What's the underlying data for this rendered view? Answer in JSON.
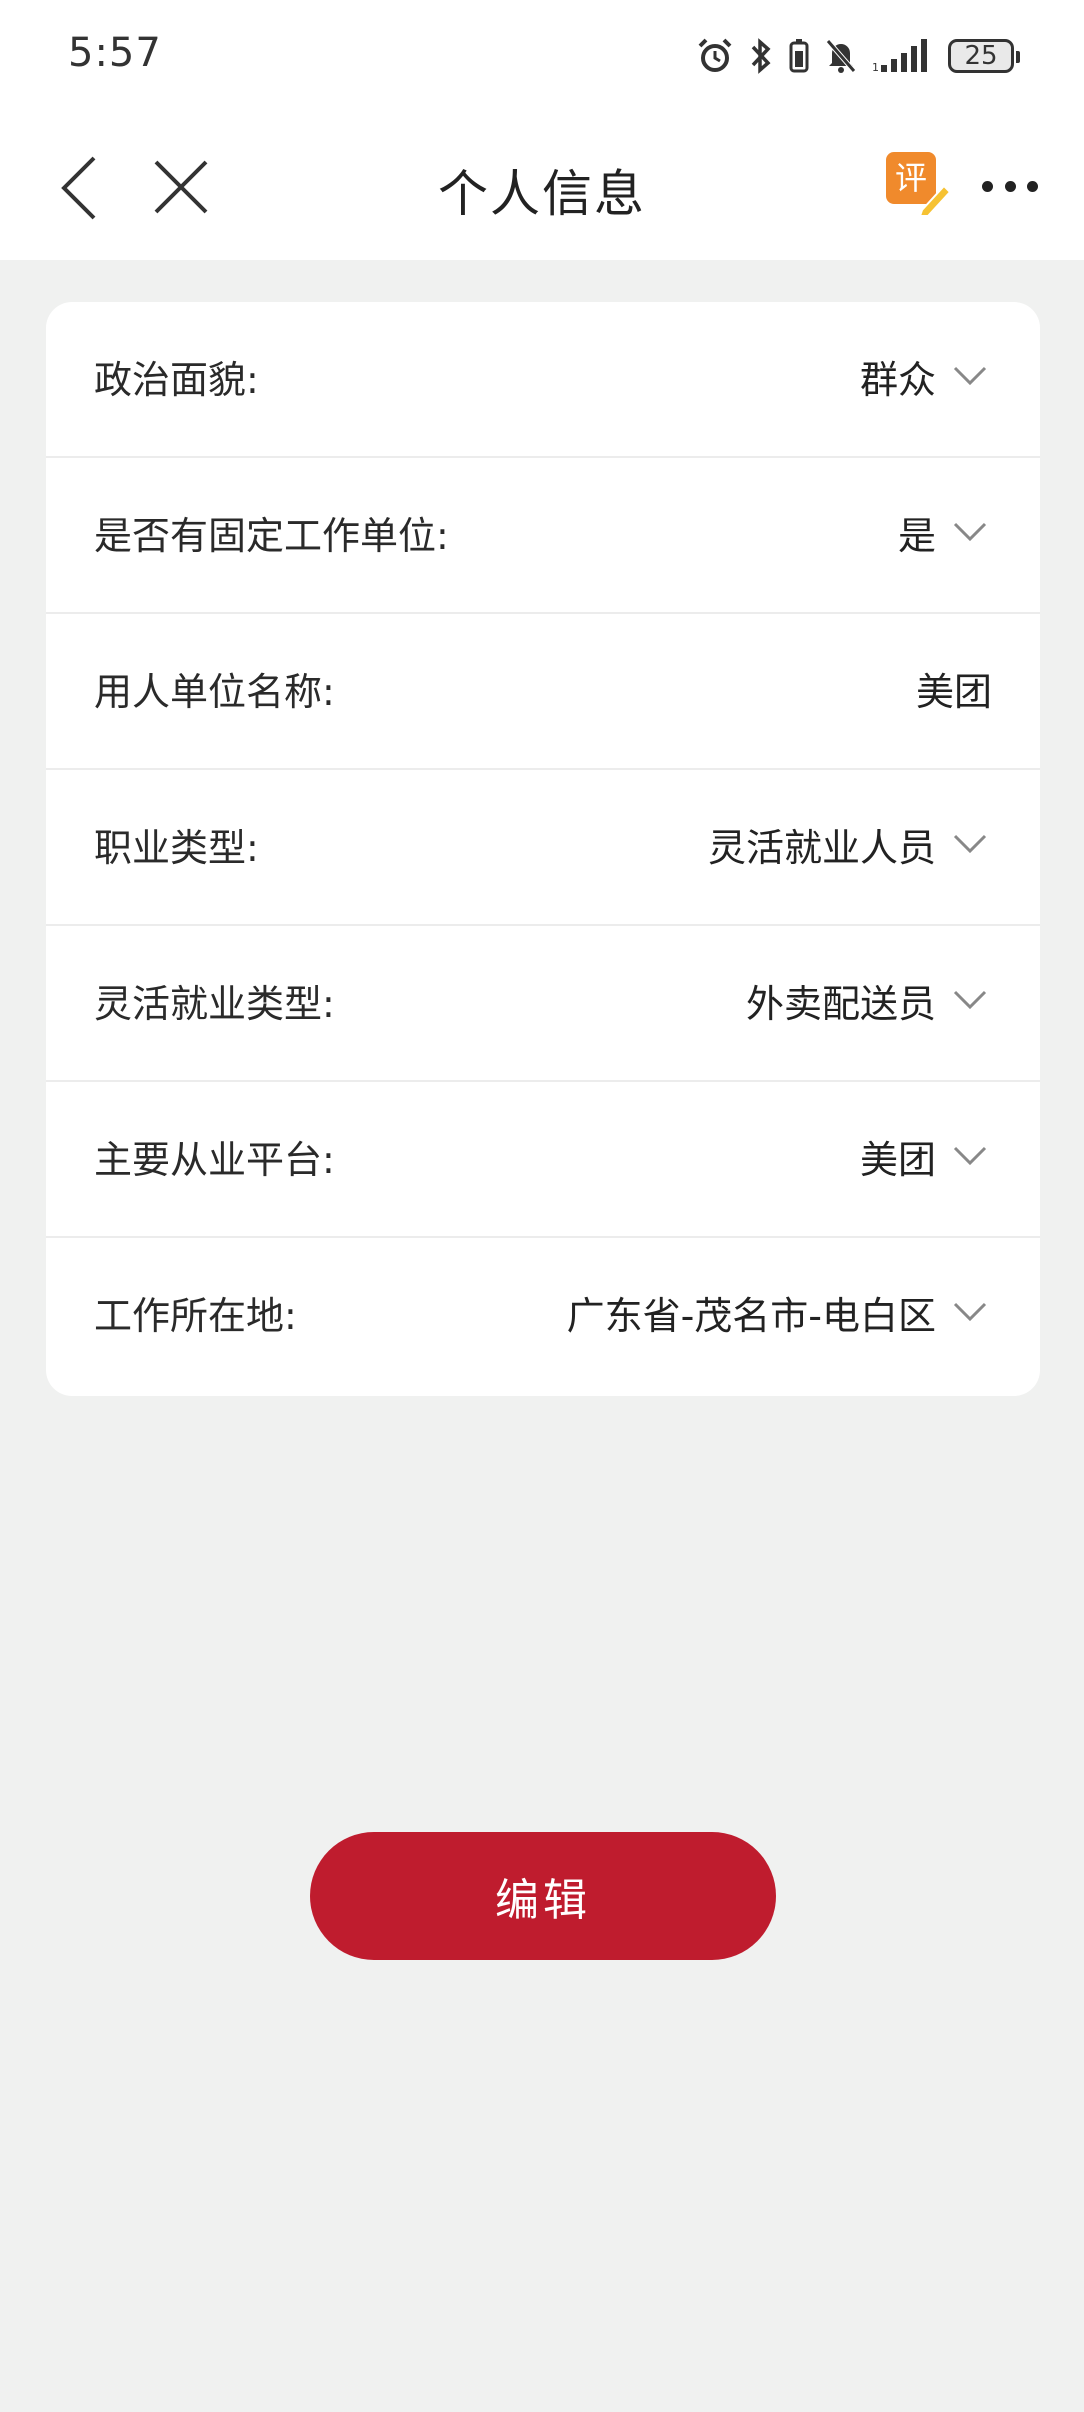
{
  "status_bar": {
    "time": "5:57",
    "battery_level": "25",
    "icons": [
      "alarm-icon",
      "bluetooth-icon",
      "battery-saver-icon",
      "mute-icon",
      "signal-icon"
    ]
  },
  "nav": {
    "title": "个人信息",
    "review_badge": "评",
    "icons": [
      "back-arrow-icon",
      "close-icon",
      "review-icon",
      "more-icon"
    ]
  },
  "form": {
    "rows": [
      {
        "label": "政治面貌:",
        "value": "群众",
        "dropdown": true
      },
      {
        "label": "是否有固定工作单位:",
        "value": "是",
        "dropdown": true
      },
      {
        "label": "用人单位名称:",
        "value": "美团",
        "dropdown": false
      },
      {
        "label": "职业类型:",
        "value": "灵活就业人员",
        "dropdown": true
      },
      {
        "label": "灵活就业类型:",
        "value": "外卖配送员",
        "dropdown": true
      },
      {
        "label": "主要从业平台:",
        "value": "美团",
        "dropdown": true
      },
      {
        "label": "工作所在地:",
        "value": "广东省-茂名市-电白区",
        "dropdown": true
      }
    ]
  },
  "actions": {
    "edit_label": "编辑"
  },
  "colors": {
    "accent": "#bf1c2e",
    "background": "#f0f1f0",
    "card": "#ffffff",
    "review_badge": "#f08a2c"
  }
}
